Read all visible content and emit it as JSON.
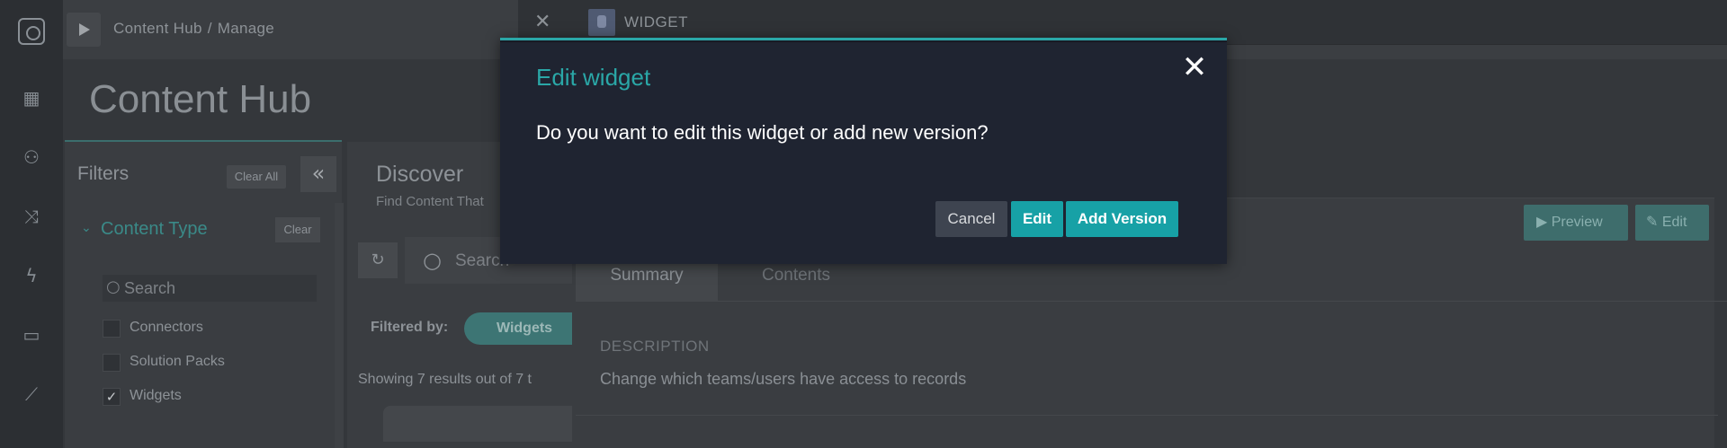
{
  "breadcrumb": {
    "root": "Content Hub",
    "separator": "/",
    "current": "Manage"
  },
  "page": {
    "title": "Content Hub"
  },
  "rail": {
    "icons": [
      "logo-icon",
      "dashboard-icon",
      "teams-icon",
      "shuffle-icon",
      "lightning-icon",
      "briefcase-icon",
      "chart-icon"
    ]
  },
  "filters": {
    "title": "Filters",
    "clear_all": "Clear All",
    "collapse": "«",
    "content_type": {
      "label": "Content Type",
      "clear": "Clear"
    },
    "search_placeholder": "Search",
    "items": [
      {
        "label": "Connectors",
        "checked": false,
        "mark": ""
      },
      {
        "label": "Solution Packs",
        "checked": false,
        "mark": ""
      },
      {
        "label": "Widgets",
        "checked": true,
        "mark": "✓"
      }
    ]
  },
  "discover": {
    "title": "Discover",
    "subtitle": "Find Content That",
    "search_placeholder": "Search",
    "filtered_by": "Filtered by:",
    "filter_pill": "Widgets",
    "results": "Showing 7 results out of 7 t"
  },
  "detail": {
    "header": "WIDGET",
    "preview_label": "▶ Preview",
    "edit_label": "✎ Edit",
    "tabs": [
      "Summary",
      "Contents"
    ],
    "description_label": "DESCRIPTION",
    "description_text": "Change which teams/users have access to records"
  },
  "modal": {
    "title": "Edit widget",
    "message": "Do you want to edit this widget or add new version?",
    "close": "✕",
    "buttons": {
      "cancel": "Cancel",
      "edit": "Edit",
      "add_version": "Add Version"
    }
  },
  "colors": {
    "accent": "#17a1a6",
    "modal_bg": "#1f2431",
    "overlay": "#34373b"
  }
}
